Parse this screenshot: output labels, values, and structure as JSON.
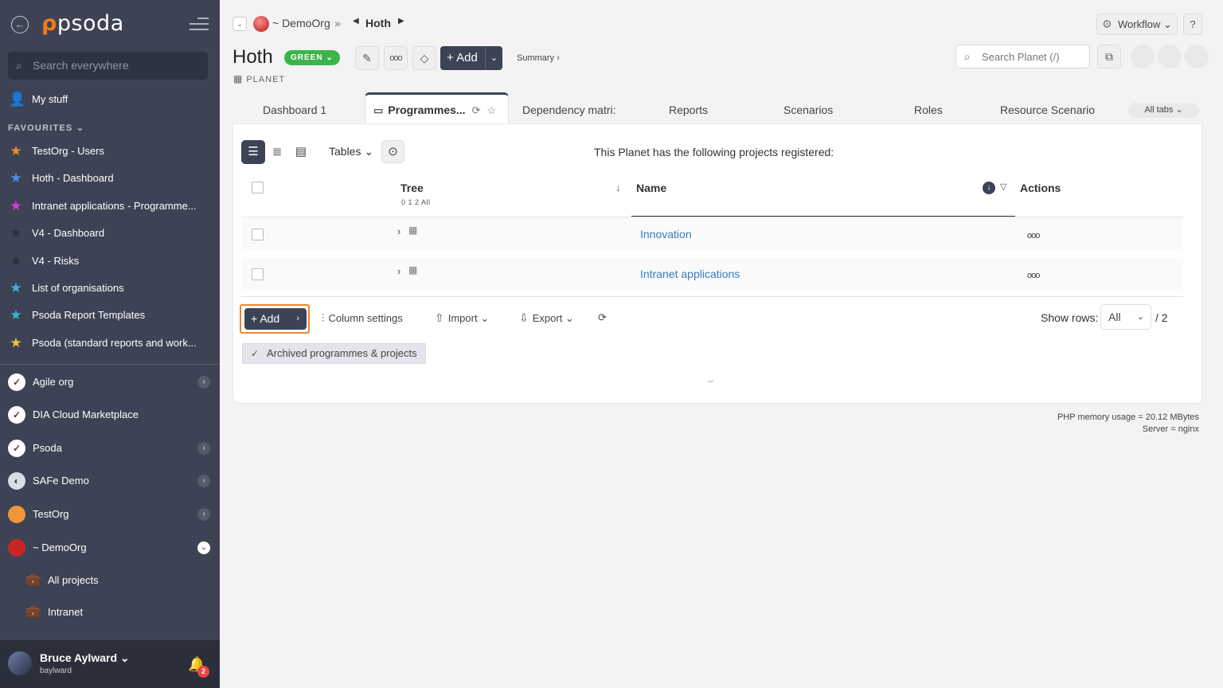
{
  "sidebar": {
    "logo": "psoda",
    "search_placeholder": "Search everywhere",
    "my_stuff": "My stuff",
    "favourites_title": "FAVOURITES",
    "favourites": [
      {
        "label": "TestOrg - Users",
        "color": "#f08a2a"
      },
      {
        "label": "Hoth - Dashboard",
        "color": "#4a90e2"
      },
      {
        "label": "Intranet applications - Programme...",
        "color": "#d63bd6"
      },
      {
        "label": "V4 - Dashboard",
        "color": "#2b2f3a"
      },
      {
        "label": "V4 - Risks",
        "color": "#2b2f3a"
      },
      {
        "label": "List of organisations",
        "color": "#34b9d6"
      },
      {
        "label": "Psoda Report Templates",
        "color": "#34b9d6"
      },
      {
        "label": "Psoda (standard reports and work...",
        "color": "#f2c12c"
      }
    ],
    "orgs": [
      {
        "label": "Agile org",
        "chevron": true
      },
      {
        "label": "DIA Cloud Marketplace",
        "chevron": false
      },
      {
        "label": "Psoda",
        "chevron": true
      },
      {
        "label": "SAFe Demo",
        "chevron": true
      },
      {
        "label": "TestOrg",
        "chevron": true
      },
      {
        "label": "~ DemoOrg",
        "chevron": true
      }
    ],
    "sub_items": [
      "All projects",
      "Intranet"
    ],
    "user": {
      "name": "Bruce Aylward",
      "username": "baylward",
      "notifications": "2"
    }
  },
  "breadcrumb": {
    "org": "~ DemoOrg",
    "current": "Hoth"
  },
  "header": {
    "title": "Hoth",
    "status": "GREEN",
    "type": "PLANET",
    "add_label": "Add",
    "summary": "Summary ›",
    "workflow": "Workflow",
    "help": "?",
    "search_placeholder": "Search Planet (/)"
  },
  "tabs": [
    {
      "label": "Dashboard 1"
    },
    {
      "label": "Programmes..."
    },
    {
      "label": "Dependency matri:"
    },
    {
      "label": "Reports"
    },
    {
      "label": "Scenarios"
    },
    {
      "label": "Roles"
    },
    {
      "label": "Resource Scenario:"
    }
  ],
  "all_tabs": "All tabs",
  "panel": {
    "tables_label": "Tables",
    "intro": "This Planet has the following projects registered:",
    "columns": {
      "tree": "Tree",
      "tree_levels": "0 1 2 All",
      "name": "Name",
      "actions": "Actions"
    },
    "rows": [
      {
        "name": "Innovation"
      },
      {
        "name": "Intranet applications"
      }
    ],
    "toolbar": {
      "add": "Add",
      "column_settings": "Column settings",
      "import": "Import",
      "export": "Export",
      "show_rows_label": "Show rows:",
      "show_rows_value": "All",
      "total": "/ 2"
    },
    "archived": "Archived programmes & projects"
  },
  "footer": {
    "memory": "PHP memory usage = 20.12 MBytes",
    "server": "Server = nginx"
  }
}
